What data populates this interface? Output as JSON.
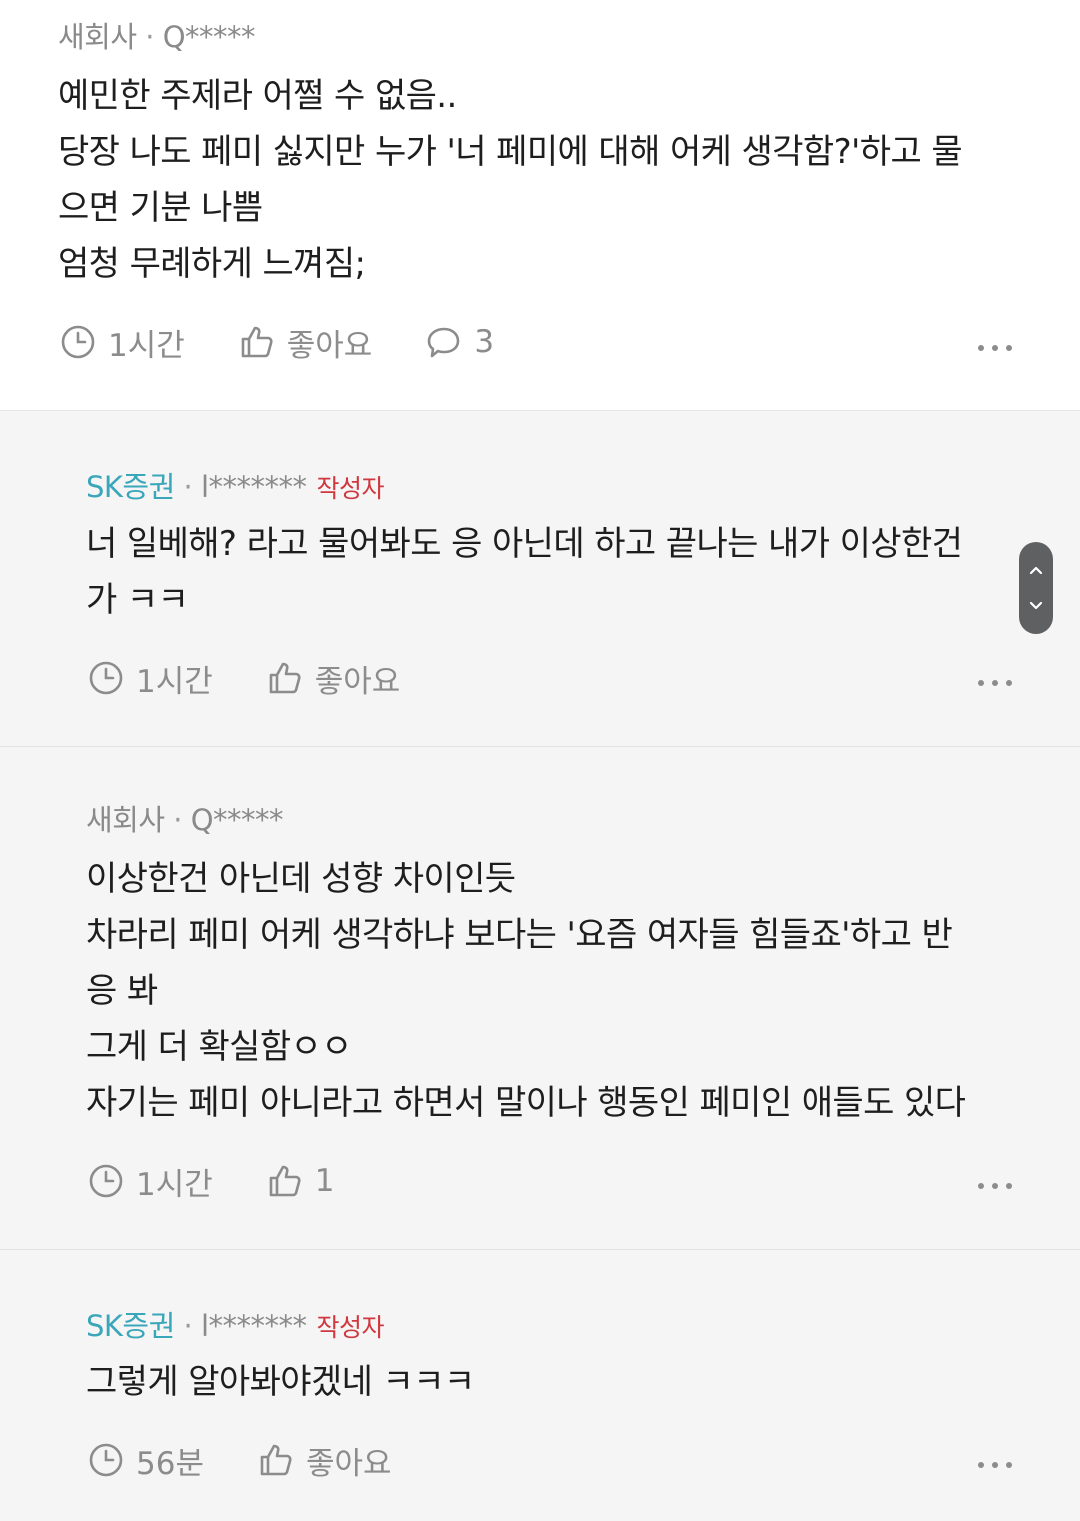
{
  "comments": [
    {
      "author_company": "새회사",
      "author_sep": " · ",
      "author_id": "Q*****",
      "text": "예민한 주제라 어쩔 수 없음..\n당장 나도 페미 싫지만 누가 '너 페미에 대해 어케 생각함?'하고 물\n으면 기분 나쁨\n엄청 무례하게 느껴짐;",
      "time": "1시간",
      "like_label": "좋아요",
      "reply_count": "3"
    },
    {
      "author_company": "SK증권",
      "author_sep": " · ",
      "author_id": "l*******",
      "author_tag": "작성자",
      "text": "너 일베해? 라고 물어봐도 응 아닌데 하고 끝나는 내가 이상한건\n가 ㅋㅋ",
      "time": "1시간",
      "like_label": "좋아요"
    },
    {
      "author_company": "새회사",
      "author_sep": " · ",
      "author_id": "Q*****",
      "text": "이상한건 아닌데 성향 차이인듯\n차라리 페미 어케 생각하냐 보다는 '요즘 여자들 힘들죠'하고 반\n응 봐\n그게 더 확실함ㅇㅇ\n자기는 페미 아니라고 하면서 말이나 행동인 페미인 애들도 있다",
      "time": "1시간",
      "like_label": "1"
    },
    {
      "author_company": "SK증권",
      "author_sep": " · ",
      "author_id": "l*******",
      "author_tag": "작성자",
      "text": "그렇게 알아봐야겠네 ㅋㅋㅋ",
      "time": "56분",
      "like_label": "좋아요"
    }
  ],
  "icons": {
    "time": "clock-icon",
    "like": "thumbs-up-icon",
    "reply": "speech-bubble-icon",
    "more": "more-dots-icon",
    "scroll_up": "chevron-up-icon",
    "scroll_down": "chevron-down-icon"
  },
  "colors": {
    "brand": "#3aa6b9",
    "author_tag": "#d0383f",
    "reply_background": "#f5f5f5"
  }
}
